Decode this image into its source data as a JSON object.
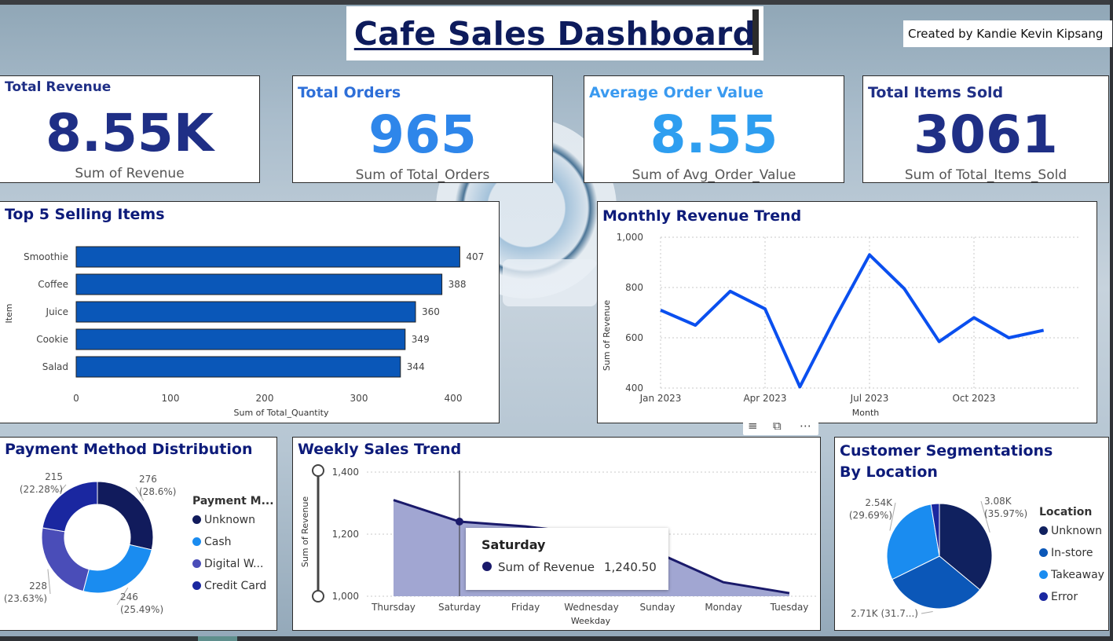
{
  "header": {
    "title": "Cafe Sales Dashboard",
    "created_by": "Created by Kandie Kevin Kipsang"
  },
  "colors": {
    "navy": "#1f2f86",
    "blue": "#2e86ea",
    "bar": "#0a57b8",
    "line": "#0a4fef",
    "area_fill": "#a1a6d2",
    "area_line": "#1a1a6b"
  },
  "kpis": [
    {
      "title": "Total Revenue",
      "value": "8.55K",
      "label": "Sum of Revenue",
      "color": "#1f2f86"
    },
    {
      "title": "Total Orders",
      "value": "965",
      "label": "Sum of Total_Orders",
      "color": "#2e86ea"
    },
    {
      "title": "Average Order Value",
      "value": "8.55",
      "label": "Sum of Avg_Order_Value",
      "color": "#2e9ef0"
    },
    {
      "title": "Total Items Sold",
      "value": "3061",
      "label": "Sum of Total_Items_Sold",
      "color": "#1f2f86"
    }
  ],
  "toolbar": {
    "filter_icon": "filter-icon",
    "focus_icon": "focus-mode-icon",
    "more_icon": "more-options-icon"
  },
  "chart_data": [
    {
      "type": "bar",
      "title": "Top 5 Selling Items",
      "orientation": "horizontal",
      "categories": [
        "Smoothie",
        "Coffee",
        "Juice",
        "Cookie",
        "Salad"
      ],
      "values": [
        407,
        388,
        360,
        349,
        344
      ],
      "xlabel": "Sum of Total_Quantity",
      "ylabel": "Item",
      "xticks": [
        "0",
        "100",
        "200",
        "300",
        "400"
      ],
      "xlim": [
        0,
        420
      ]
    },
    {
      "type": "line",
      "title": "Monthly Revenue Trend",
      "x": [
        "2023-01",
        "2023-02",
        "2023-03",
        "2023-04",
        "2023-05",
        "2023-06",
        "2023-07",
        "2023-08",
        "2023-09",
        "2023-10",
        "2023-11",
        "2023-12"
      ],
      "values": [
        710,
        650,
        785,
        715,
        405,
        675,
        930,
        795,
        585,
        680,
        600,
        630
      ],
      "xlabel": "Month",
      "ylabel": "Sum of Revenue",
      "xticks": [
        "Jan 2023",
        "Apr 2023",
        "Jul 2023",
        "Oct 2023"
      ],
      "yticks": [
        "400",
        "600",
        "800",
        "1,000"
      ],
      "ylim": [
        400,
        1000
      ],
      "grid": true
    },
    {
      "type": "pie",
      "title": "Payment Method Distribution",
      "variant": "donut",
      "legend_title": "Payment M...",
      "categories": [
        "Unknown",
        "Cash",
        "Digital W...",
        "Credit Card"
      ],
      "values": [
        276,
        246,
        228,
        215
      ],
      "data_labels": [
        {
          "value": "276",
          "percent": "(28.6%)"
        },
        {
          "value": "246",
          "percent": "(25.49%)"
        },
        {
          "value": "228",
          "percent": "(23.63%)"
        },
        {
          "value": "215",
          "percent": "(22.28%)"
        }
      ],
      "colors": [
        "#111b5c",
        "#1a8cf0",
        "#4a4db8",
        "#1a27a0"
      ],
      "legend_position": "right"
    },
    {
      "type": "area",
      "title": "Weekly Sales Trend",
      "categories": [
        "Thursday",
        "Saturday",
        "Friday",
        "Wednesday",
        "Sunday",
        "Monday",
        "Tuesday"
      ],
      "values": [
        1310,
        1240.5,
        1225,
        1200,
        1140,
        1045,
        1010
      ],
      "xlabel": "Weekday",
      "ylabel": "Sum of Revenue",
      "yticks": [
        "1,000",
        "1,200",
        "1,400"
      ],
      "ylim": [
        1000,
        1400
      ],
      "tooltip": {
        "title": "Saturday",
        "measure": "Sum of Revenue",
        "value": "1,240.50"
      }
    },
    {
      "type": "pie",
      "title": "Customer Segmentations By Location",
      "legend_title": "Location",
      "categories": [
        "Unknown",
        "In-store",
        "Takeaway",
        "Error"
      ],
      "values": [
        3080,
        2710,
        2540,
        220
      ],
      "data_labels": [
        {
          "value": "3.08K",
          "percent": "(35.97%)"
        },
        {
          "value": "2.71K (31.7...)",
          "percent": ""
        },
        {
          "value": "2.54K",
          "percent": "(29.69%)"
        }
      ],
      "colors": [
        "#10215f",
        "#0b57b8",
        "#1a8cf0",
        "#1a27a0"
      ],
      "legend_position": "right"
    }
  ]
}
